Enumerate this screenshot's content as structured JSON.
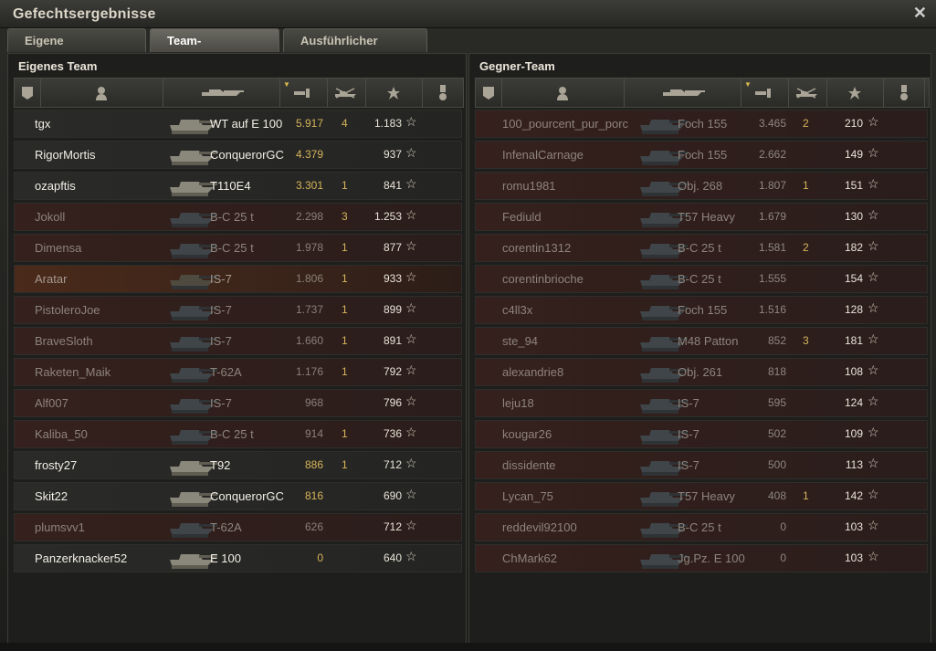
{
  "window": {
    "title": "Gefechtsergebnisse"
  },
  "tabs": [
    {
      "label": "Eigene Auswertung"
    },
    {
      "label": "Team-Auswertung"
    },
    {
      "label": "Ausführlicher Bericht"
    }
  ],
  "left_team": {
    "title": "Eigenes Team",
    "rows": [
      {
        "name": "tgx",
        "vehicle": "WT auf E 100",
        "damage": "5.917",
        "kills": "4",
        "xp": "1.183",
        "state": "alive"
      },
      {
        "name": "RigorMortis",
        "vehicle": "ConquerorGC",
        "damage": "4.379",
        "kills": "",
        "xp": "937",
        "state": "alive"
      },
      {
        "name": "ozapftis",
        "vehicle": "T110E4",
        "damage": "3.301",
        "kills": "1",
        "xp": "841",
        "state": "alive"
      },
      {
        "name": "Jokoll",
        "vehicle": "B-C 25 t",
        "damage": "2.298",
        "kills": "3",
        "xp": "1.253",
        "state": "dead"
      },
      {
        "name": "Dimensa",
        "vehicle": "B-C 25 t",
        "damage": "1.978",
        "kills": "1",
        "xp": "877",
        "state": "dead"
      },
      {
        "name": "Aratar",
        "vehicle": "IS-7",
        "damage": "1.806",
        "kills": "1",
        "xp": "933",
        "state": "self"
      },
      {
        "name": "PistoleroJoe",
        "vehicle": "IS-7",
        "damage": "1.737",
        "kills": "1",
        "xp": "899",
        "state": "dead"
      },
      {
        "name": "BraveSloth",
        "vehicle": "IS-7",
        "damage": "1.660",
        "kills": "1",
        "xp": "891",
        "state": "dead"
      },
      {
        "name": "Raketen_Maik",
        "vehicle": "T-62A",
        "damage": "1.176",
        "kills": "1",
        "xp": "792",
        "state": "dead"
      },
      {
        "name": "Alf007",
        "vehicle": "IS-7",
        "damage": "968",
        "kills": "",
        "xp": "796",
        "state": "dead"
      },
      {
        "name": "Kaliba_50",
        "vehicle": "B-C 25 t",
        "damage": "914",
        "kills": "1",
        "xp": "736",
        "state": "dead"
      },
      {
        "name": "frosty27",
        "vehicle": "T92",
        "damage": "886",
        "kills": "1",
        "xp": "712",
        "state": "alive"
      },
      {
        "name": "Skit22",
        "vehicle": "ConquerorGC",
        "damage": "816",
        "kills": "",
        "xp": "690",
        "state": "alive"
      },
      {
        "name": "plumsvv1",
        "vehicle": "T-62A",
        "damage": "626",
        "kills": "",
        "xp": "712",
        "state": "dead"
      },
      {
        "name": "Panzerknacker52",
        "vehicle": "E 100",
        "damage": "0",
        "kills": "",
        "xp": "640",
        "state": "alive"
      }
    ]
  },
  "right_team": {
    "title": "Gegner-Team",
    "rows": [
      {
        "name": "100_pourcent_pur_porc",
        "vehicle": "Foch 155",
        "damage": "3.465",
        "kills": "2",
        "xp": "210",
        "state": "dead"
      },
      {
        "name": "InfenalCarnage",
        "vehicle": "Foch 155",
        "damage": "2.662",
        "kills": "",
        "xp": "149",
        "state": "dead"
      },
      {
        "name": "romu1981",
        "vehicle": "Obj. 268",
        "damage": "1.807",
        "kills": "1",
        "xp": "151",
        "state": "dead"
      },
      {
        "name": "Fediuld",
        "vehicle": "T57 Heavy",
        "damage": "1.679",
        "kills": "",
        "xp": "130",
        "state": "dead"
      },
      {
        "name": "corentin1312",
        "vehicle": "B-C 25 t",
        "damage": "1.581",
        "kills": "2",
        "xp": "182",
        "state": "dead"
      },
      {
        "name": "corentinbrioche",
        "vehicle": "B-C 25 t",
        "damage": "1.555",
        "kills": "",
        "xp": "154",
        "state": "dead"
      },
      {
        "name": "c4ll3x",
        "vehicle": "Foch 155",
        "damage": "1.516",
        "kills": "",
        "xp": "128",
        "state": "dead"
      },
      {
        "name": "ste_94",
        "vehicle": "M48 Patton",
        "damage": "852",
        "kills": "3",
        "xp": "181",
        "state": "dead"
      },
      {
        "name": "alexandrie8",
        "vehicle": "Obj. 261",
        "damage": "818",
        "kills": "",
        "xp": "108",
        "state": "dead"
      },
      {
        "name": "leju18",
        "vehicle": "IS-7",
        "damage": "595",
        "kills": "",
        "xp": "124",
        "state": "dead"
      },
      {
        "name": "kougar26",
        "vehicle": "IS-7",
        "damage": "502",
        "kills": "",
        "xp": "109",
        "state": "dead"
      },
      {
        "name": "dissidente",
        "vehicle": "IS-7",
        "damage": "500",
        "kills": "",
        "xp": "113",
        "state": "dead"
      },
      {
        "name": "Lycan_75",
        "vehicle": "T57 Heavy",
        "damage": "408",
        "kills": "1",
        "xp": "142",
        "state": "dead"
      },
      {
        "name": "reddevil92100",
        "vehicle": "B-C 25 t",
        "damage": "0",
        "kills": "",
        "xp": "103",
        "state": "dead"
      },
      {
        "name": "ChMark62",
        "vehicle": "Jg.Pz. E 100",
        "damage": "0",
        "kills": "",
        "xp": "103",
        "state": "dead"
      }
    ]
  },
  "icons": {
    "close": "close-icon",
    "platoon": "platoon-icon",
    "player": "player-icon",
    "vehicle": "vehicle-icon",
    "damage": "damage-icon",
    "kills": "kills-icon",
    "xp": "xp-star-icon",
    "medal": "medal-icon",
    "row_star": "star-icon"
  },
  "colors": {
    "accent_gold": "#d6b45a",
    "dead_row": "#35201d",
    "self_row": "#4a2a1a"
  }
}
